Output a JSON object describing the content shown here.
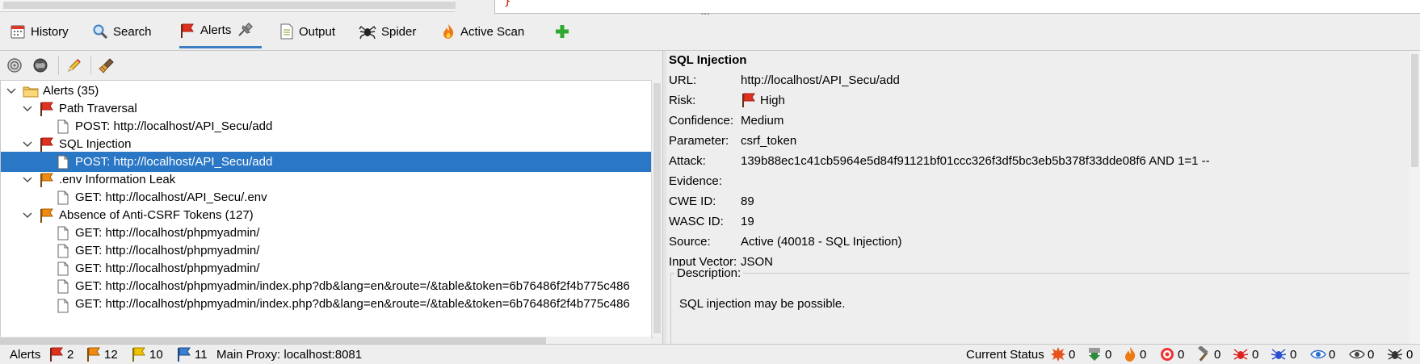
{
  "tabs": [
    {
      "label": "History",
      "icon": "calendar-icon"
    },
    {
      "label": "Search",
      "icon": "magnifier-icon"
    },
    {
      "label": "Alerts",
      "icon": "flag-icon",
      "active": true
    },
    {
      "label": "Output",
      "icon": "document-icon"
    },
    {
      "label": "Spider",
      "icon": "spider-icon"
    },
    {
      "label": "Active Scan",
      "icon": "flame-icon"
    }
  ],
  "tree": {
    "root": "Alerts (35)",
    "groups": [
      {
        "label": "Path Traversal",
        "risk": "high",
        "items": [
          "POST: http://localhost/API_Secu/add"
        ]
      },
      {
        "label": "SQL Injection",
        "risk": "high",
        "items": [
          "POST: http://localhost/API_Secu/add"
        ]
      },
      {
        "label": ".env Information Leak",
        "risk": "medium",
        "items": [
          "GET: http://localhost/API_Secu/.env"
        ]
      },
      {
        "label": "Absence of Anti-CSRF Tokens (127)",
        "risk": "medium",
        "items": [
          "GET: http://localhost/phpmyadmin/",
          "GET: http://localhost/phpmyadmin/",
          "GET: http://localhost/phpmyadmin/",
          "GET: http://localhost/phpmyadmin/index.php?db&lang=en&route=/&table&token=6b76486f2f4b775c486",
          "GET: http://localhost/phpmyadmin/index.php?db&lang=en&route=/&table&token=6b76486f2f4b775c486"
        ]
      }
    ]
  },
  "details": {
    "title": "SQL Injection",
    "labels": {
      "url": "URL:",
      "risk": "Risk:",
      "confidence": "Confidence:",
      "parameter": "Parameter:",
      "attack": "Attack:",
      "evidence": "Evidence:",
      "cwe": "CWE ID:",
      "wasc": "WASC ID:",
      "source": "Source:",
      "input_vector": "Input Vector:",
      "description": "Description:"
    },
    "url": "http://localhost/API_Secu/add",
    "risk": "High",
    "confidence": "Medium",
    "parameter": "csrf_token",
    "attack": "139b88ec1c41cb5964e5d84f91121bf01ccc326f3df5bc3eb5b378f33dde08f6 AND 1=1 --",
    "evidence": "",
    "cwe": "89",
    "wasc": "19",
    "source": "Active (40018 - SQL Injection)",
    "input_vector": "JSON",
    "description": "SQL injection may be possible."
  },
  "status": {
    "alerts_label": "Alerts",
    "high": "2",
    "medium": "12",
    "low": "10",
    "info": "11",
    "proxy": "Main Proxy: localhost:8081",
    "current_status": "Current Status",
    "counters": [
      "0",
      "0",
      "0",
      "0",
      "0",
      "0",
      "0",
      "0",
      "0",
      "0"
    ]
  },
  "colors": {
    "accent": "#2a77c6",
    "high_flag": "#e0311e",
    "medium_flag": "#f08a10",
    "low_flag": "#f2c200",
    "info_flag": "#3a7fd0"
  }
}
